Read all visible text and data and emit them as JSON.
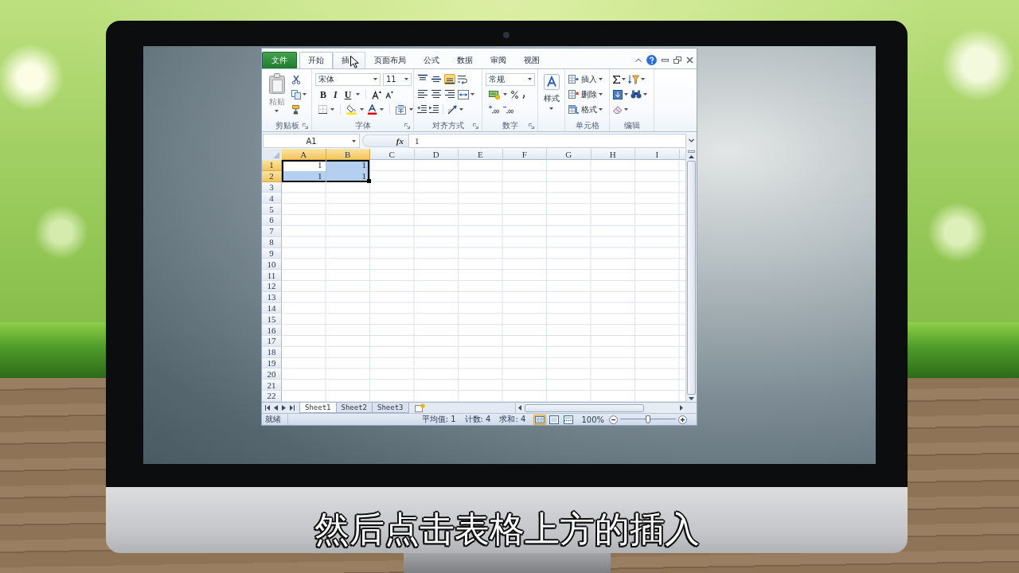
{
  "excel": {
    "tabs": [
      {
        "label": "文件",
        "kind": "file",
        "selected": false,
        "hovered": false
      },
      {
        "label": "开始",
        "kind": "tab",
        "selected": true,
        "hovered": false
      },
      {
        "label": "插",
        "kind": "tab",
        "selected": false,
        "hovered": true
      },
      {
        "label": "页面布局",
        "kind": "tab",
        "selected": false,
        "hovered": false
      },
      {
        "label": "公式",
        "kind": "tab",
        "selected": false,
        "hovered": false
      },
      {
        "label": "数据",
        "kind": "tab",
        "selected": false,
        "hovered": false
      },
      {
        "label": "审阅",
        "kind": "tab",
        "selected": false,
        "hovered": false
      },
      {
        "label": "视图",
        "kind": "tab",
        "selected": false,
        "hovered": false
      }
    ],
    "ribbon": [
      {
        "kind": "clipboard",
        "label": "剪贴板",
        "button": "粘贴",
        "disabled": true
      },
      {
        "kind": "font",
        "label": "字体",
        "font": "宋体",
        "size": "11",
        "styles": [
          {
            "kind": "bold",
            "label": "B"
          },
          {
            "kind": "italic",
            "label": "I"
          },
          {
            "kind": "underline",
            "label": "U"
          }
        ]
      },
      {
        "kind": "alignment",
        "label": "对齐方式",
        "vertical": [
          {
            "kind": "top",
            "selected": false
          },
          {
            "kind": "middle",
            "selected": false
          },
          {
            "kind": "bottom",
            "selected": true
          }
        ]
      },
      {
        "kind": "number",
        "label": "数字",
        "format": "常规"
      },
      {
        "kind": "styles",
        "button": "样式"
      },
      {
        "kind": "cells",
        "label": "单元格",
        "items": [
          {
            "kind": "insert",
            "label": "插入"
          },
          {
            "kind": "delete",
            "label": "删除"
          },
          {
            "kind": "format",
            "label": "格式"
          }
        ]
      },
      {
        "kind": "editing",
        "label": "编辑"
      }
    ],
    "name_box": "A1",
    "function_button": "fx",
    "formula": "1",
    "columns": [
      {
        "label": "A",
        "selected": true
      },
      {
        "label": "B",
        "selected": true
      },
      {
        "label": "C",
        "selected": false
      },
      {
        "label": "D",
        "selected": false
      },
      {
        "label": "E",
        "selected": false
      },
      {
        "label": "F",
        "selected": false
      },
      {
        "label": "G",
        "selected": false
      },
      {
        "label": "H",
        "selected": false
      },
      {
        "label": "I",
        "selected": false
      }
    ],
    "rows": [
      {
        "label": "1",
        "selected": true,
        "cells": [
          {
            "value": "1",
            "selected": true,
            "active": true
          },
          {
            "value": "1",
            "selected": true,
            "active": false
          }
        ]
      },
      {
        "label": "2",
        "selected": true,
        "cells": [
          {
            "value": "1",
            "selected": true,
            "active": false
          },
          {
            "value": "1",
            "selected": true,
            "active": false
          }
        ]
      },
      {
        "label": "3",
        "selected": false
      },
      {
        "label": "4",
        "selected": false
      },
      {
        "label": "5",
        "selected": false
      },
      {
        "label": "6",
        "selected": false
      },
      {
        "label": "7",
        "selected": false
      },
      {
        "label": "8",
        "selected": false
      },
      {
        "label": "9",
        "selected": false
      },
      {
        "label": "10",
        "selected": false
      },
      {
        "label": "11",
        "selected": false
      },
      {
        "label": "12",
        "selected": false
      },
      {
        "label": "13",
        "selected": false
      },
      {
        "label": "14",
        "selected": false
      },
      {
        "label": "15",
        "selected": false
      },
      {
        "label": "16",
        "selected": false
      },
      {
        "label": "17",
        "selected": false
      },
      {
        "label": "18",
        "selected": false
      },
      {
        "label": "19",
        "selected": false
      },
      {
        "label": "20",
        "selected": false
      },
      {
        "label": "21",
        "selected": false
      },
      {
        "label": "22",
        "selected": false
      }
    ],
    "sheets": [
      {
        "label": "Sheet1",
        "selected": true
      },
      {
        "label": "Sheet2",
        "selected": false
      },
      {
        "label": "Sheet3",
        "selected": false
      }
    ],
    "status": {
      "ready": "就绪",
      "stats": [
        "平均值: 1",
        "计数: 4",
        "求和: 4"
      ],
      "views": [
        {
          "kind": "normal",
          "selected": true
        },
        {
          "kind": "page-layout",
          "selected": false
        },
        {
          "kind": "page-break",
          "selected": false
        }
      ],
      "zoom": "100%",
      "zoom_slider": {
        "level": 0.5
      }
    }
  },
  "subtitle": "然后点击表格上方的插入"
}
